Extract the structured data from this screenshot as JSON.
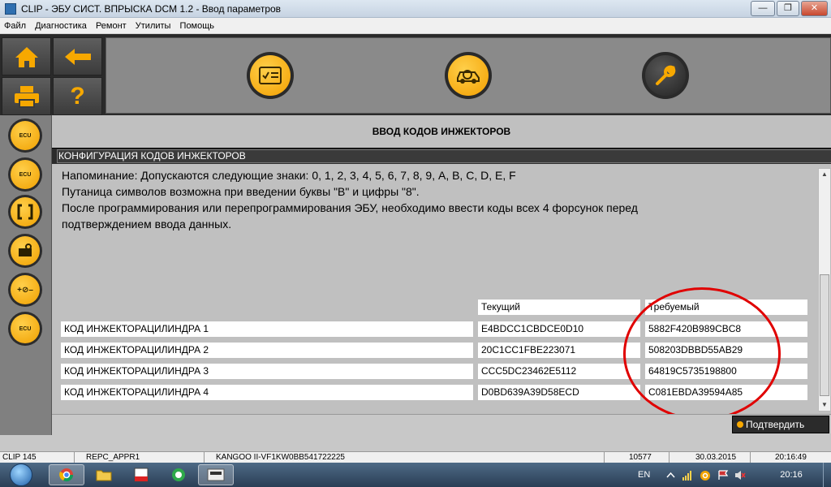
{
  "window": {
    "title": "CLIP - ЭБУ СИСТ. ВПРЫСКА DCM 1.2 - Ввод параметров",
    "minimize_label": "—",
    "maximize_label": "❐",
    "close_label": "✕"
  },
  "menu": {
    "items": [
      "Файл",
      "Диагностика",
      "Ремонт",
      "Утилиты",
      "Помощь"
    ]
  },
  "toolbar": {
    "home_icon": "home-icon",
    "back_icon": "back-arrow-icon",
    "print_icon": "printer-icon",
    "help_label": "?",
    "buttons": [
      "checklist-icon",
      "vehicle-diagnostic-icon",
      "wrench-icon"
    ]
  },
  "sidebar": {
    "items": [
      {
        "icon": "ecu-info-icon",
        "label": "ECU"
      },
      {
        "icon": "ecu-edit-icon",
        "label": "ECU"
      },
      {
        "icon": "bracket-icon",
        "label": ""
      },
      {
        "icon": "engine-key-icon",
        "label": ""
      },
      {
        "icon": "plus-minus-icon",
        "label": "+⊘–"
      },
      {
        "icon": "ecu-plug-icon",
        "label": "ECU"
      }
    ]
  },
  "page": {
    "title": "ВВОД КОДОВ ИНЖЕКТОРОВ",
    "section": "КОНФИГУРАЦИЯ КОДОВ ИНЖЕКТОРОВ",
    "notes": [
      "Напоминание: Допускаются следующие знаки:  0, 1, 2, 3, 4, 5, 6, 7, 8, 9, A, B, C, D, E, F",
      "Путаница символов возможна при введении буквы \"B\" и цифры \"8\".",
      "После программирования или перепрограммирования ЭБУ, необходимо ввести коды всех 4 форсунок перед",
      "подтверждением ввода данных."
    ]
  },
  "table": {
    "columns": {
      "current": "Текущий",
      "required": "Требуемый"
    },
    "rows": [
      {
        "label": "КОД ИНЖЕКТОРАЦИЛИНДРА 1",
        "current": "E4BDCC1CBDCE0D10",
        "required": "5882F420B989CBC8"
      },
      {
        "label": "КОД ИНЖЕКТОРАЦИЛИНДРА 2",
        "current": "20C1CC1FBE223071",
        "required": "508203DBBD55AB29"
      },
      {
        "label": "КОД ИНЖЕКТОРАЦИЛИНДРА 3",
        "current": "CCC5DC23462E5112",
        "required": "64819C5735198800"
      },
      {
        "label": "КОД ИНЖЕКТОРАЦИЛИНДРА 4",
        "current": "D0BD639A39D58ECD",
        "required": "C081EBDA39594A85"
      }
    ]
  },
  "actions": {
    "confirm_label": "Подтвердить"
  },
  "status": {
    "clip": "CLIP 145",
    "repc": "REPC_APPR1",
    "vehicle": "KANGOO II-VF1KW0BB541722225",
    "code": "10577",
    "date": "30.03.2015",
    "time": "20:16:49"
  },
  "taskbar": {
    "language": "EN",
    "clock": "20:16",
    "apps": [
      "chrome-icon",
      "explorer-folder-icon",
      "alt-app-icon",
      "green-app-icon",
      "clip-app-icon"
    ]
  },
  "colors": {
    "accent_yellow": "#f7a800",
    "panel_gray": "#c0c0c0",
    "dark_bar": "#2b2b2b",
    "annotation_red": "#e00000"
  }
}
